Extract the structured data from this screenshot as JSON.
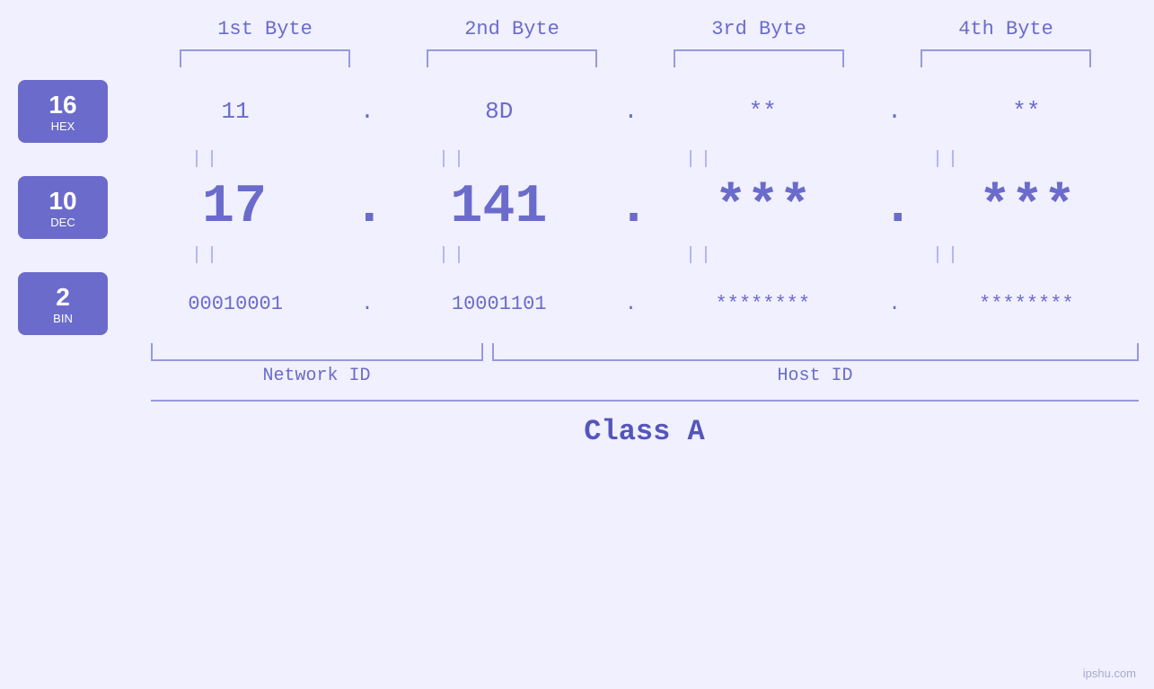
{
  "headers": {
    "byte1": "1st Byte",
    "byte2": "2nd Byte",
    "byte3": "3rd Byte",
    "byte4": "4th Byte"
  },
  "bases": {
    "hex": {
      "num": "16",
      "name": "HEX"
    },
    "dec": {
      "num": "10",
      "name": "DEC"
    },
    "bin": {
      "num": "2",
      "name": "BIN"
    }
  },
  "hex_values": {
    "b1": "11",
    "b2": "8D",
    "b3": "**",
    "b4": "**",
    "dot": "."
  },
  "dec_values": {
    "b1": "17",
    "b2": "141",
    "b3": "***",
    "b4": "***",
    "dot": "."
  },
  "bin_values": {
    "b1": "00010001",
    "b2": "10001101",
    "b3": "********",
    "b4": "********",
    "dot": "."
  },
  "labels": {
    "network_id": "Network ID",
    "host_id": "Host ID",
    "class": "Class A",
    "watermark": "ipshu.com"
  }
}
